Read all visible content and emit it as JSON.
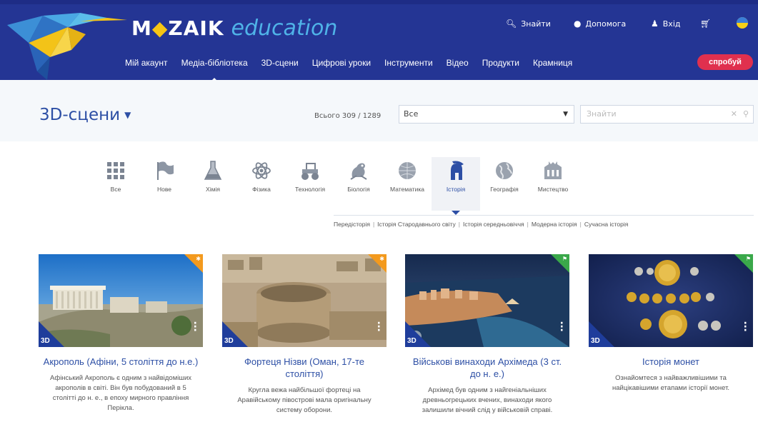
{
  "header": {
    "brand": "M",
    "brand_rest": "ZAIK",
    "brand_sub": "education",
    "search_label": "Знайти",
    "help_label": "Допомога",
    "login_label": "Вхід",
    "cta_label": "спробуй"
  },
  "nav": {
    "items": [
      "Мій акаунт",
      "Медіа-бібліотека",
      "3D-сцени",
      "Цифрові уроки",
      "Інструменти",
      "Відео",
      "Продукти",
      "Крамниця"
    ],
    "active_index": 1
  },
  "filter": {
    "title": "3D-сцени",
    "count_text": "Всього 309 / 1289",
    "select_value": "Все",
    "search_placeholder": "Знайти"
  },
  "categories": [
    {
      "label": "Все",
      "icon": "grid-icon"
    },
    {
      "label": "Нове",
      "icon": "flag-icon"
    },
    {
      "label": "Хімія",
      "icon": "flask-icon"
    },
    {
      "label": "Фізика",
      "icon": "atom-icon"
    },
    {
      "label": "Технологія",
      "icon": "tractor-icon"
    },
    {
      "label": "Біологія",
      "icon": "frog-icon"
    },
    {
      "label": "Математика",
      "icon": "sphere-icon"
    },
    {
      "label": "Історія",
      "icon": "helmet-icon"
    },
    {
      "label": "Географія",
      "icon": "globe-icon"
    },
    {
      "label": "Мистецтво",
      "icon": "building-icon"
    }
  ],
  "active_category": "Історія",
  "subcategories": [
    "Передісторія",
    "Історія Стародавнього світу",
    "Історія середньовіччя",
    "Модерна історія",
    "Сучасна історія"
  ],
  "cards": [
    {
      "title": "Акрополь (Афіни, 5 століття до н.е.)",
      "desc": "Афінський Акрополь є одним з найвідоміших акрополів в світі. Він був побудований в 5 столітті до н. е., в епоху мирного правління Перікла.",
      "badge": "3D",
      "corner_color": "#f39a1e"
    },
    {
      "title": "Фортеця Нізви (Оман, 17-те століття)",
      "desc": "Кругла вежа найбільшої фортеці на Аравійському півострові мала оригінальну систему оборони.",
      "badge": "3D",
      "corner_color": "#f39a1e"
    },
    {
      "title": "Військові винаходи Архімеда (3 ст. до н. е.)",
      "desc": "Архімед був одним з найгеніальніших древньогрецьких вчених, винаходи якого залишили вічний слід у військовій справі.",
      "badge": "3D",
      "corner_color": "#3aa84a"
    },
    {
      "title": "Історія монет",
      "desc": "Ознайомтеся з найважливішими та найцікавішими етапами історії монет.",
      "badge": "3D",
      "corner_color": "#3aa84a"
    }
  ]
}
